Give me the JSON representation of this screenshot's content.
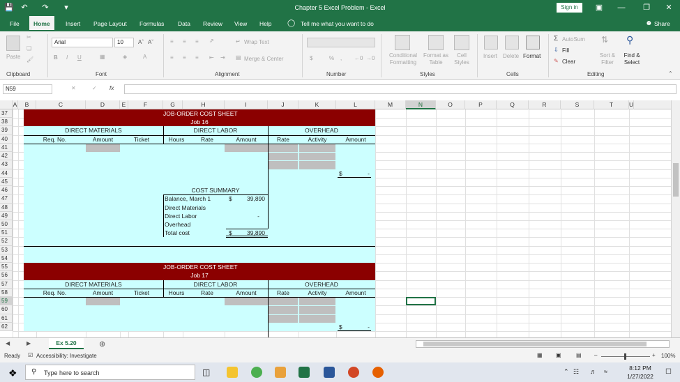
{
  "window": {
    "title": "Chapter 5 Excel Problem  -  Excel",
    "signin": "Sign in"
  },
  "tabs": [
    "File",
    "Home",
    "Insert",
    "Page Layout",
    "Formulas",
    "Data",
    "Review",
    "View",
    "Help"
  ],
  "tell_me": "Tell me what you want to do",
  "share": "Share",
  "ribbon": {
    "paste": "Paste",
    "font_name": "Arial",
    "font_size": "10",
    "clipboard": "Clipboard",
    "font": "Font",
    "alignment": "Alignment",
    "number": "Number",
    "styles": "Styles",
    "cells": "Cells",
    "editing": "Editing",
    "wrap_text": "Wrap Text",
    "merge_center": "Merge & Center",
    "currency": "$",
    "percent": "%",
    "conditional_formatting": "Conditional Formatting",
    "format_as_table": "Format as Table",
    "cell_styles": "Cell Styles",
    "insert": "Insert",
    "delete": "Delete",
    "format": "Format",
    "autosum": "AutoSum",
    "fill": "Fill",
    "clear": "Clear",
    "sort_filter": "Sort & Filter",
    "find_select": "Find & Select"
  },
  "name_box": "N59",
  "fx": "fx",
  "columns": [
    "A",
    "B",
    "C",
    "D",
    "E",
    "F",
    "G",
    "H",
    "I",
    "J",
    "K",
    "L",
    "M",
    "N",
    "O",
    "P",
    "Q",
    "R",
    "S",
    "T",
    "U"
  ],
  "rows": [
    "37",
    "38",
    "39",
    "40",
    "41",
    "42",
    "43",
    "44",
    "45",
    "46",
    "47",
    "48",
    "49",
    "50",
    "51",
    "52",
    "53",
    "54",
    "55",
    "56",
    "57",
    "58",
    "59",
    "60",
    "61",
    "62"
  ],
  "sheet1": {
    "title": "JOB-ORDER COST SHEET",
    "job": "Job 16",
    "dm": "DIRECT MATERIALS",
    "dl": "DIRECT LABOR",
    "oh": "OVERHEAD",
    "h_req": "Req. No.",
    "h_amount": "Amount",
    "h_ticket": "Ticket",
    "h_hours": "Hours",
    "h_rate": "Rate",
    "h_amount2": "Amount",
    "h_rate2": "Rate",
    "h_activity": "Activity",
    "h_amount3": "Amount",
    "oh_total_sym": "$",
    "oh_total": "-",
    "cs_title": "COST SUMMARY",
    "cs_balance": "Balance, March 1",
    "cs_balance_sym": "$",
    "cs_balance_val": "39,890",
    "cs_dm": "Direct Materials",
    "cs_dl": "Direct Labor",
    "cs_dl_val": "-",
    "cs_oh": "Overhead",
    "cs_total": "Total cost",
    "cs_total_sym": "$",
    "cs_total_val": "39,890"
  },
  "sheet2": {
    "title": "JOB-ORDER COST SHEET",
    "job": "Job 17",
    "dm": "DIRECT MATERIALS",
    "dl": "DIRECT LABOR",
    "oh": "OVERHEAD",
    "h_req": "Req. No.",
    "h_amount": "Amount",
    "h_ticket": "Ticket",
    "h_hours": "Hours",
    "h_rate": "Rate",
    "h_amount2": "Amount",
    "h_rate2": "Rate",
    "h_activity": "Activity",
    "h_amount3": "Amount",
    "oh_total_sym": "$",
    "oh_total": "-"
  },
  "sheet_tab": "Ex 5.20",
  "status": {
    "ready": "Ready",
    "accessibility": "Accessibility: Investigate",
    "zoom": "100%"
  },
  "taskbar": {
    "search": "Type here to search",
    "time": "8:12 PM",
    "date": "1/27/2022"
  },
  "colors": {
    "excel_green": "#217346",
    "header_red": "#8b0000",
    "cyan": "#ccffff",
    "gray": "#bfbfbf"
  }
}
